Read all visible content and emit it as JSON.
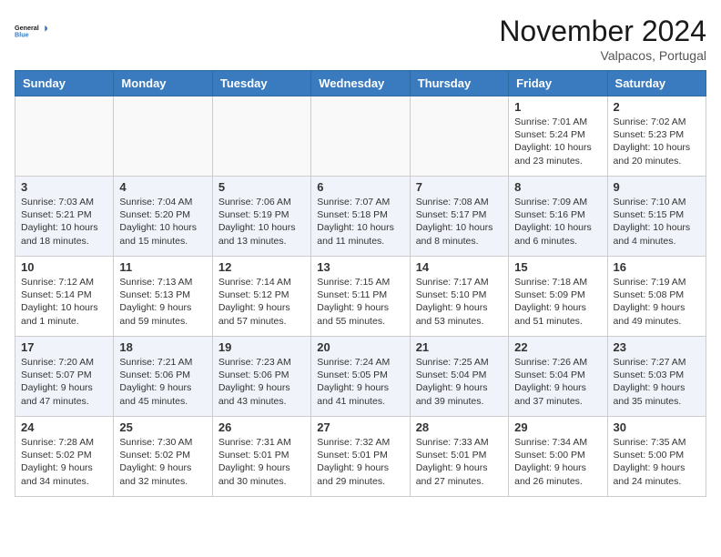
{
  "header": {
    "logo_line1": "General",
    "logo_line2": "Blue",
    "month": "November 2024",
    "location": "Valpacos, Portugal"
  },
  "weekdays": [
    "Sunday",
    "Monday",
    "Tuesday",
    "Wednesday",
    "Thursday",
    "Friday",
    "Saturday"
  ],
  "weeks": [
    [
      {
        "day": "",
        "info": ""
      },
      {
        "day": "",
        "info": ""
      },
      {
        "day": "",
        "info": ""
      },
      {
        "day": "",
        "info": ""
      },
      {
        "day": "",
        "info": ""
      },
      {
        "day": "1",
        "info": "Sunrise: 7:01 AM\nSunset: 5:24 PM\nDaylight: 10 hours\nand 23 minutes."
      },
      {
        "day": "2",
        "info": "Sunrise: 7:02 AM\nSunset: 5:23 PM\nDaylight: 10 hours\nand 20 minutes."
      }
    ],
    [
      {
        "day": "3",
        "info": "Sunrise: 7:03 AM\nSunset: 5:21 PM\nDaylight: 10 hours\nand 18 minutes."
      },
      {
        "day": "4",
        "info": "Sunrise: 7:04 AM\nSunset: 5:20 PM\nDaylight: 10 hours\nand 15 minutes."
      },
      {
        "day": "5",
        "info": "Sunrise: 7:06 AM\nSunset: 5:19 PM\nDaylight: 10 hours\nand 13 minutes."
      },
      {
        "day": "6",
        "info": "Sunrise: 7:07 AM\nSunset: 5:18 PM\nDaylight: 10 hours\nand 11 minutes."
      },
      {
        "day": "7",
        "info": "Sunrise: 7:08 AM\nSunset: 5:17 PM\nDaylight: 10 hours\nand 8 minutes."
      },
      {
        "day": "8",
        "info": "Sunrise: 7:09 AM\nSunset: 5:16 PM\nDaylight: 10 hours\nand 6 minutes."
      },
      {
        "day": "9",
        "info": "Sunrise: 7:10 AM\nSunset: 5:15 PM\nDaylight: 10 hours\nand 4 minutes."
      }
    ],
    [
      {
        "day": "10",
        "info": "Sunrise: 7:12 AM\nSunset: 5:14 PM\nDaylight: 10 hours\nand 1 minute."
      },
      {
        "day": "11",
        "info": "Sunrise: 7:13 AM\nSunset: 5:13 PM\nDaylight: 9 hours\nand 59 minutes."
      },
      {
        "day": "12",
        "info": "Sunrise: 7:14 AM\nSunset: 5:12 PM\nDaylight: 9 hours\nand 57 minutes."
      },
      {
        "day": "13",
        "info": "Sunrise: 7:15 AM\nSunset: 5:11 PM\nDaylight: 9 hours\nand 55 minutes."
      },
      {
        "day": "14",
        "info": "Sunrise: 7:17 AM\nSunset: 5:10 PM\nDaylight: 9 hours\nand 53 minutes."
      },
      {
        "day": "15",
        "info": "Sunrise: 7:18 AM\nSunset: 5:09 PM\nDaylight: 9 hours\nand 51 minutes."
      },
      {
        "day": "16",
        "info": "Sunrise: 7:19 AM\nSunset: 5:08 PM\nDaylight: 9 hours\nand 49 minutes."
      }
    ],
    [
      {
        "day": "17",
        "info": "Sunrise: 7:20 AM\nSunset: 5:07 PM\nDaylight: 9 hours\nand 47 minutes."
      },
      {
        "day": "18",
        "info": "Sunrise: 7:21 AM\nSunset: 5:06 PM\nDaylight: 9 hours\nand 45 minutes."
      },
      {
        "day": "19",
        "info": "Sunrise: 7:23 AM\nSunset: 5:06 PM\nDaylight: 9 hours\nand 43 minutes."
      },
      {
        "day": "20",
        "info": "Sunrise: 7:24 AM\nSunset: 5:05 PM\nDaylight: 9 hours\nand 41 minutes."
      },
      {
        "day": "21",
        "info": "Sunrise: 7:25 AM\nSunset: 5:04 PM\nDaylight: 9 hours\nand 39 minutes."
      },
      {
        "day": "22",
        "info": "Sunrise: 7:26 AM\nSunset: 5:04 PM\nDaylight: 9 hours\nand 37 minutes."
      },
      {
        "day": "23",
        "info": "Sunrise: 7:27 AM\nSunset: 5:03 PM\nDaylight: 9 hours\nand 35 minutes."
      }
    ],
    [
      {
        "day": "24",
        "info": "Sunrise: 7:28 AM\nSunset: 5:02 PM\nDaylight: 9 hours\nand 34 minutes."
      },
      {
        "day": "25",
        "info": "Sunrise: 7:30 AM\nSunset: 5:02 PM\nDaylight: 9 hours\nand 32 minutes."
      },
      {
        "day": "26",
        "info": "Sunrise: 7:31 AM\nSunset: 5:01 PM\nDaylight: 9 hours\nand 30 minutes."
      },
      {
        "day": "27",
        "info": "Sunrise: 7:32 AM\nSunset: 5:01 PM\nDaylight: 9 hours\nand 29 minutes."
      },
      {
        "day": "28",
        "info": "Sunrise: 7:33 AM\nSunset: 5:01 PM\nDaylight: 9 hours\nand 27 minutes."
      },
      {
        "day": "29",
        "info": "Sunrise: 7:34 AM\nSunset: 5:00 PM\nDaylight: 9 hours\nand 26 minutes."
      },
      {
        "day": "30",
        "info": "Sunrise: 7:35 AM\nSunset: 5:00 PM\nDaylight: 9 hours\nand 24 minutes."
      }
    ]
  ]
}
